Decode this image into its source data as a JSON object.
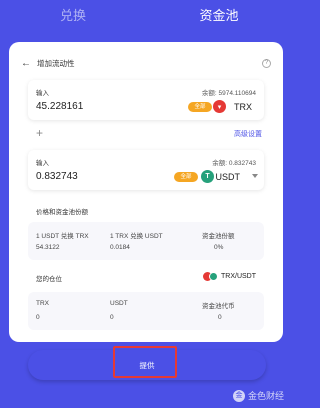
{
  "tabs": [
    {
      "label": "兑换",
      "active": false
    },
    {
      "label": "资金池",
      "active": true
    }
  ],
  "header": {
    "title": "增加流动性",
    "back_icon": "arrow-left-icon",
    "help_icon": "question-circle-icon"
  },
  "input1": {
    "label": "输入",
    "balance": "余额: 5974.110694",
    "value": "45.228161",
    "max_label": "全部",
    "token": "TRX",
    "token_color": "#e53935"
  },
  "advanced_label": "高级设置",
  "input2": {
    "label": "输入",
    "balance": "余额: 0.832743",
    "value": "0.832743",
    "max_label": "全部",
    "token": "USDT",
    "token_color": "#26a17b"
  },
  "price_section": {
    "title": "价格和资金池份额",
    "items": [
      {
        "label": "1 USDT 兑换 TRX",
        "value": "54.3122"
      },
      {
        "label": "1 TRX 兑换 USDT",
        "value": "0.0184"
      },
      {
        "label": "资金池份额",
        "value": "0%"
      }
    ]
  },
  "position_section": {
    "title": "您的仓位",
    "pair": "TRX/USDT",
    "items": [
      {
        "label": "TRX",
        "value": "0"
      },
      {
        "label": "USDT",
        "value": "0"
      },
      {
        "label": "资金池代币",
        "value": "0"
      }
    ]
  },
  "submit_label": "提供",
  "watermark": {
    "text": "金色财经",
    "logo_char": "金"
  },
  "colors": {
    "accent": "#4b50e6",
    "max_button": "#f5a623",
    "highlight": "#e53935"
  }
}
